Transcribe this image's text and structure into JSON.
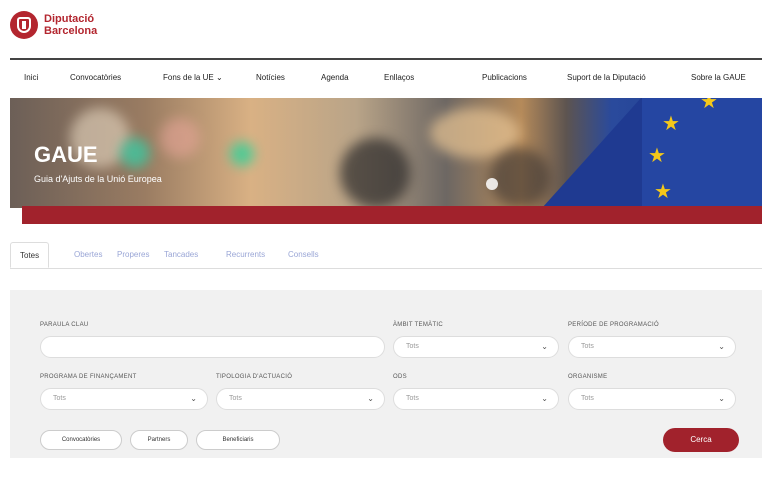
{
  "brand": {
    "line1": "Diputació",
    "line2": "Barcelona"
  },
  "nav": {
    "items": [
      "Inici",
      "Convocatòries",
      "Fons de la UE",
      "Notícies",
      "Agenda",
      "Enllaços",
      "Publicacions",
      "Suport de la Diputació",
      "Sobre la GAUE"
    ]
  },
  "hero": {
    "title": "GAUE",
    "subtitle": "Guia d'Ajuts de la Unió Europea"
  },
  "tabs": [
    "Totes",
    "Obertes",
    "Properes",
    "Tancades",
    "Recurrents",
    "Consells"
  ],
  "filters": {
    "paraula_label": "PARAULA CLAU",
    "ambit_label": "ÀMBIT TEMÀTIC",
    "periode_label": "PERÍODE DE PROGRAMACIÓ",
    "programa_label": "PROGRAMA DE FINANÇAMENT",
    "tipologia_label": "TIPOLOGIA D'ACTUACIÓ",
    "ods_label": "ODS",
    "organisme_label": "ORGANISME",
    "select_placeholder": "Tots"
  },
  "chips": [
    "Convocatòries",
    "Partners",
    "Beneficiaris"
  ],
  "search_button": "Cerca",
  "colors": {
    "brand_red": "#a1222c",
    "eu_blue": "#1f3a91",
    "eu_star": "#f4c81a"
  }
}
